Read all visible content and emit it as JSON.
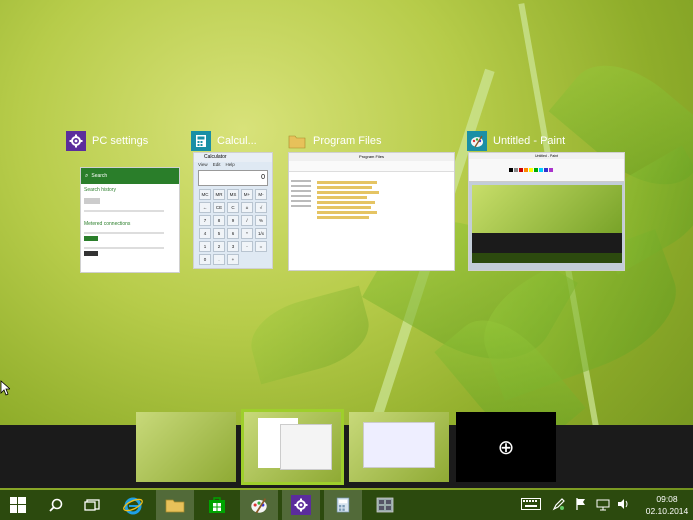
{
  "task_view": {
    "windows": [
      {
        "title": "PC settings",
        "icon": "gear-icon",
        "icon_color": "#5b2d9c"
      },
      {
        "title": "Calcul...",
        "icon": "calculator-icon",
        "icon_color": "#1a8fa5"
      },
      {
        "title": "Program Files",
        "icon": "folder-icon",
        "icon_color": "#e0b84a"
      },
      {
        "title": "Untitled - Paint",
        "icon": "paint-icon",
        "icon_color": "#1a8fa5"
      }
    ],
    "pc_settings_thumb": {
      "search_label": "Search",
      "search_history": "Search history",
      "metered": "Metered connections"
    },
    "calc_thumb": {
      "title": "Calculator",
      "menu": [
        "View",
        "Edit",
        "Help"
      ],
      "display": "0",
      "keys": [
        "MC",
        "MR",
        "MS",
        "M+",
        "M-",
        "←",
        "CE",
        "C",
        "±",
        "√",
        "7",
        "8",
        "9",
        "/",
        "%",
        "4",
        "5",
        "6",
        "*",
        "1/x",
        "1",
        "2",
        "3",
        "-",
        "=",
        "0",
        ".",
        "+"
      ]
    },
    "explorer_thumb": {
      "title": "Program Files"
    },
    "paint_thumb": {
      "title": "Untitled - Paint"
    }
  },
  "desktops": {
    "add_label": "⊕"
  },
  "taskbar": {
    "start_icon": "windows-logo-icon",
    "search_icon": "search-icon",
    "taskview_icon": "task-view-icon",
    "apps": [
      "ie-icon",
      "file-explorer-icon",
      "store-icon",
      "paint-icon",
      "gear-icon",
      "calculator-icon",
      "network-icon"
    ],
    "clock_time": "09:08",
    "clock_date": "02.10.2014"
  }
}
